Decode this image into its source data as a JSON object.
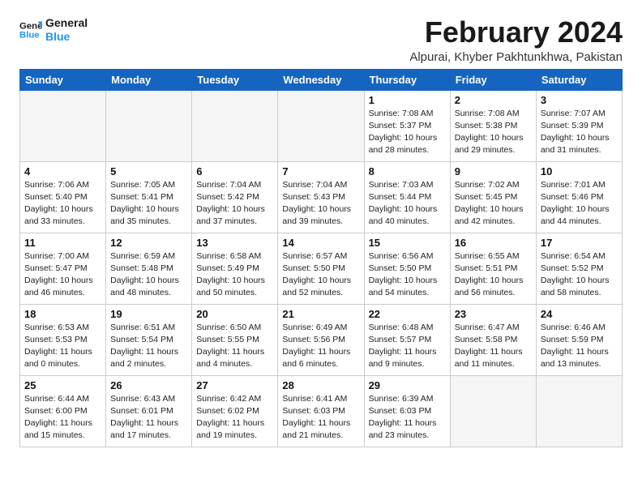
{
  "logo": {
    "line1": "General",
    "line2": "Blue"
  },
  "title": "February 2024",
  "subtitle": "Alpurai, Khyber Pakhtunkhwa, Pakistan",
  "headers": [
    "Sunday",
    "Monday",
    "Tuesday",
    "Wednesday",
    "Thursday",
    "Friday",
    "Saturday"
  ],
  "weeks": [
    [
      {
        "day": "",
        "info": ""
      },
      {
        "day": "",
        "info": ""
      },
      {
        "day": "",
        "info": ""
      },
      {
        "day": "",
        "info": ""
      },
      {
        "day": "1",
        "info": "Sunrise: 7:08 AM\nSunset: 5:37 PM\nDaylight: 10 hours\nand 28 minutes."
      },
      {
        "day": "2",
        "info": "Sunrise: 7:08 AM\nSunset: 5:38 PM\nDaylight: 10 hours\nand 29 minutes."
      },
      {
        "day": "3",
        "info": "Sunrise: 7:07 AM\nSunset: 5:39 PM\nDaylight: 10 hours\nand 31 minutes."
      }
    ],
    [
      {
        "day": "4",
        "info": "Sunrise: 7:06 AM\nSunset: 5:40 PM\nDaylight: 10 hours\nand 33 minutes."
      },
      {
        "day": "5",
        "info": "Sunrise: 7:05 AM\nSunset: 5:41 PM\nDaylight: 10 hours\nand 35 minutes."
      },
      {
        "day": "6",
        "info": "Sunrise: 7:04 AM\nSunset: 5:42 PM\nDaylight: 10 hours\nand 37 minutes."
      },
      {
        "day": "7",
        "info": "Sunrise: 7:04 AM\nSunset: 5:43 PM\nDaylight: 10 hours\nand 39 minutes."
      },
      {
        "day": "8",
        "info": "Sunrise: 7:03 AM\nSunset: 5:44 PM\nDaylight: 10 hours\nand 40 minutes."
      },
      {
        "day": "9",
        "info": "Sunrise: 7:02 AM\nSunset: 5:45 PM\nDaylight: 10 hours\nand 42 minutes."
      },
      {
        "day": "10",
        "info": "Sunrise: 7:01 AM\nSunset: 5:46 PM\nDaylight: 10 hours\nand 44 minutes."
      }
    ],
    [
      {
        "day": "11",
        "info": "Sunrise: 7:00 AM\nSunset: 5:47 PM\nDaylight: 10 hours\nand 46 minutes."
      },
      {
        "day": "12",
        "info": "Sunrise: 6:59 AM\nSunset: 5:48 PM\nDaylight: 10 hours\nand 48 minutes."
      },
      {
        "day": "13",
        "info": "Sunrise: 6:58 AM\nSunset: 5:49 PM\nDaylight: 10 hours\nand 50 minutes."
      },
      {
        "day": "14",
        "info": "Sunrise: 6:57 AM\nSunset: 5:50 PM\nDaylight: 10 hours\nand 52 minutes."
      },
      {
        "day": "15",
        "info": "Sunrise: 6:56 AM\nSunset: 5:50 PM\nDaylight: 10 hours\nand 54 minutes."
      },
      {
        "day": "16",
        "info": "Sunrise: 6:55 AM\nSunset: 5:51 PM\nDaylight: 10 hours\nand 56 minutes."
      },
      {
        "day": "17",
        "info": "Sunrise: 6:54 AM\nSunset: 5:52 PM\nDaylight: 10 hours\nand 58 minutes."
      }
    ],
    [
      {
        "day": "18",
        "info": "Sunrise: 6:53 AM\nSunset: 5:53 PM\nDaylight: 11 hours\nand 0 minutes."
      },
      {
        "day": "19",
        "info": "Sunrise: 6:51 AM\nSunset: 5:54 PM\nDaylight: 11 hours\nand 2 minutes."
      },
      {
        "day": "20",
        "info": "Sunrise: 6:50 AM\nSunset: 5:55 PM\nDaylight: 11 hours\nand 4 minutes."
      },
      {
        "day": "21",
        "info": "Sunrise: 6:49 AM\nSunset: 5:56 PM\nDaylight: 11 hours\nand 6 minutes."
      },
      {
        "day": "22",
        "info": "Sunrise: 6:48 AM\nSunset: 5:57 PM\nDaylight: 11 hours\nand 9 minutes."
      },
      {
        "day": "23",
        "info": "Sunrise: 6:47 AM\nSunset: 5:58 PM\nDaylight: 11 hours\nand 11 minutes."
      },
      {
        "day": "24",
        "info": "Sunrise: 6:46 AM\nSunset: 5:59 PM\nDaylight: 11 hours\nand 13 minutes."
      }
    ],
    [
      {
        "day": "25",
        "info": "Sunrise: 6:44 AM\nSunset: 6:00 PM\nDaylight: 11 hours\nand 15 minutes."
      },
      {
        "day": "26",
        "info": "Sunrise: 6:43 AM\nSunset: 6:01 PM\nDaylight: 11 hours\nand 17 minutes."
      },
      {
        "day": "27",
        "info": "Sunrise: 6:42 AM\nSunset: 6:02 PM\nDaylight: 11 hours\nand 19 minutes."
      },
      {
        "day": "28",
        "info": "Sunrise: 6:41 AM\nSunset: 6:03 PM\nDaylight: 11 hours\nand 21 minutes."
      },
      {
        "day": "29",
        "info": "Sunrise: 6:39 AM\nSunset: 6:03 PM\nDaylight: 11 hours\nand 23 minutes."
      },
      {
        "day": "",
        "info": ""
      },
      {
        "day": "",
        "info": ""
      }
    ]
  ]
}
